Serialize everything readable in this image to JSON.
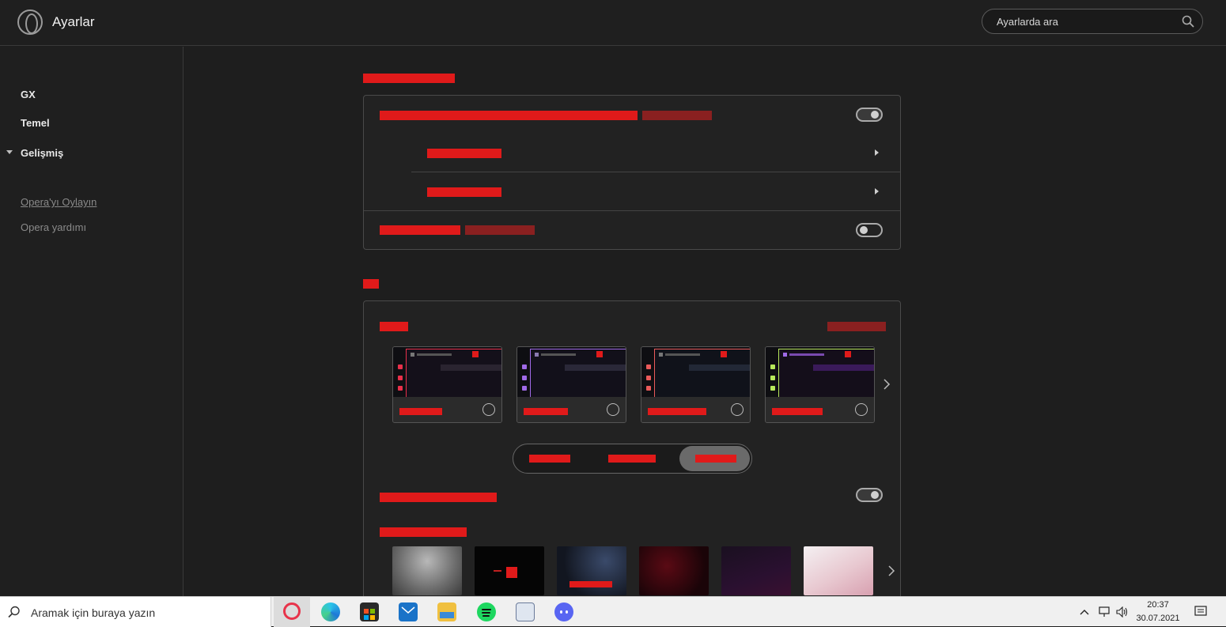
{
  "header": {
    "title": "Ayarlar",
    "search_placeholder": "Ayarlarda ara"
  },
  "sidebar": {
    "items": [
      {
        "label": "GX"
      },
      {
        "label": "Temel"
      },
      {
        "label": "Gelişmiş"
      }
    ],
    "links": [
      {
        "label": "Opera'yı Oylayın"
      },
      {
        "label": "Opera yardımı"
      }
    ]
  },
  "main": {
    "section1": {
      "toggle1": "on",
      "toggle2": "off"
    },
    "section2": {
      "themes": [
        {
          "accent": "#e8304a"
        },
        {
          "accent": "#a06ae8"
        },
        {
          "accent": "#ea5a5a"
        },
        {
          "accent": "#b6e85a"
        }
      ],
      "segment_active_index": 2,
      "toggle3": "on"
    }
  },
  "taskbar": {
    "search_placeholder": "Aramak için buraya yazın",
    "time": "20:37",
    "date": "30.07.2021"
  },
  "colors": {
    "accent_red": "#e01a1a",
    "background": "#1e1e1e"
  }
}
